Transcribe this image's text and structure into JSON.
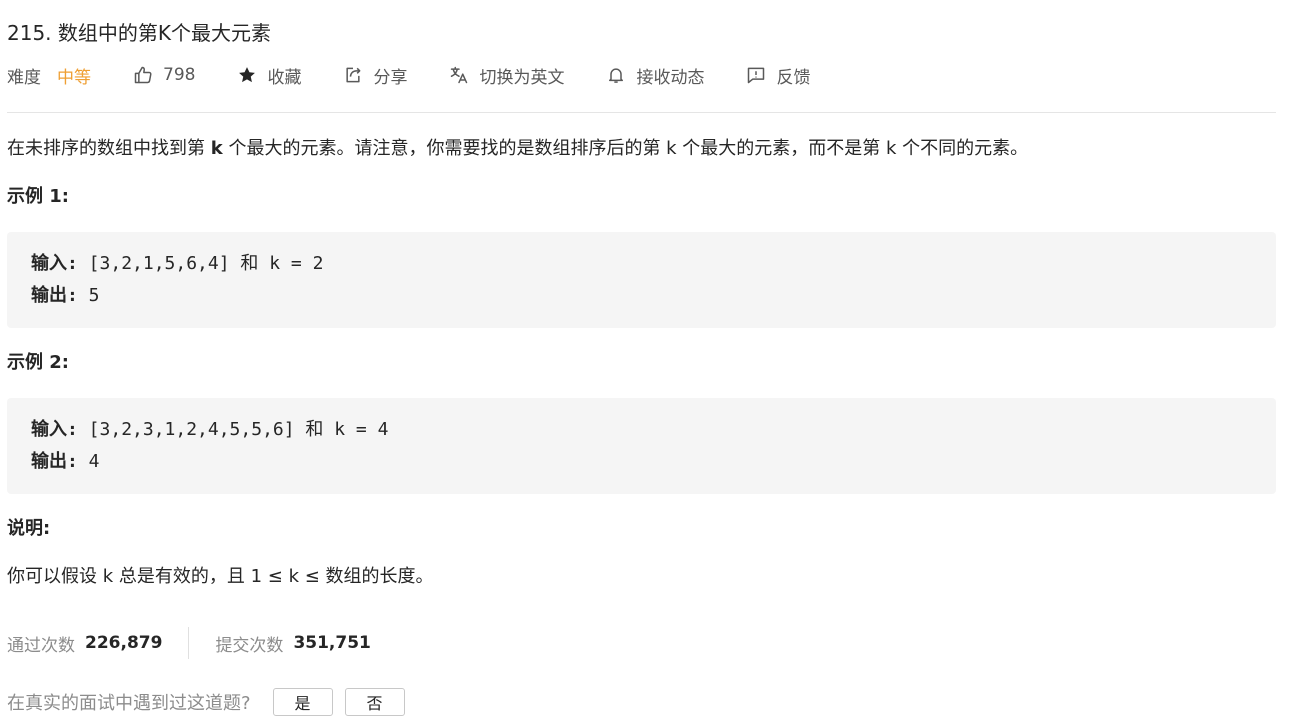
{
  "problem": {
    "title": "215. 数组中的第K个最大元素",
    "difficulty_label": "难度",
    "difficulty_value": "中等",
    "likes": "798",
    "favorite_label": "收藏",
    "share_label": "分享",
    "switch_lang_label": "切换为英文",
    "subscribe_label": "接收动态",
    "feedback_label": "反馈"
  },
  "description": {
    "part1": "在未排序的数组中找到第 ",
    "bold_k": "k",
    "part2": " 个最大的元素。请注意，你需要找的是数组排序后的第 k 个最大的元素，而不是第 k 个不同的元素。"
  },
  "examples": [
    {
      "heading": "示例 1:",
      "input_label": "输入:",
      "input_value": " [3,2,1,5,6,4] 和 k = 2",
      "output_label": "输出:",
      "output_value": " 5"
    },
    {
      "heading": "示例 2:",
      "input_label": "输入:",
      "input_value": " [3,2,3,1,2,4,5,5,6] 和 k = 4",
      "output_label": "输出:",
      "output_value": " 4"
    }
  ],
  "note": {
    "heading": "说明:",
    "text": "你可以假设 k 总是有效的，且 1 ≤ k ≤ 数组的长度。"
  },
  "stats": {
    "accepted_label": "通过次数",
    "accepted_value": "226,879",
    "submissions_label": "提交次数",
    "submissions_value": "351,751"
  },
  "interview": {
    "question": "在真实的面试中遇到过这道题?",
    "yes_label": "是",
    "no_label": "否"
  },
  "icons": {
    "like": "thumbs-up-icon",
    "favorite": "star-icon",
    "share": "share-icon",
    "translate": "translate-icon",
    "subscribe": "bell-icon",
    "feedback": "feedback-icon"
  },
  "colors": {
    "difficulty_medium": "#ef9f33",
    "code_background": "#f5f5f5",
    "muted_text": "#8c8c8c"
  }
}
